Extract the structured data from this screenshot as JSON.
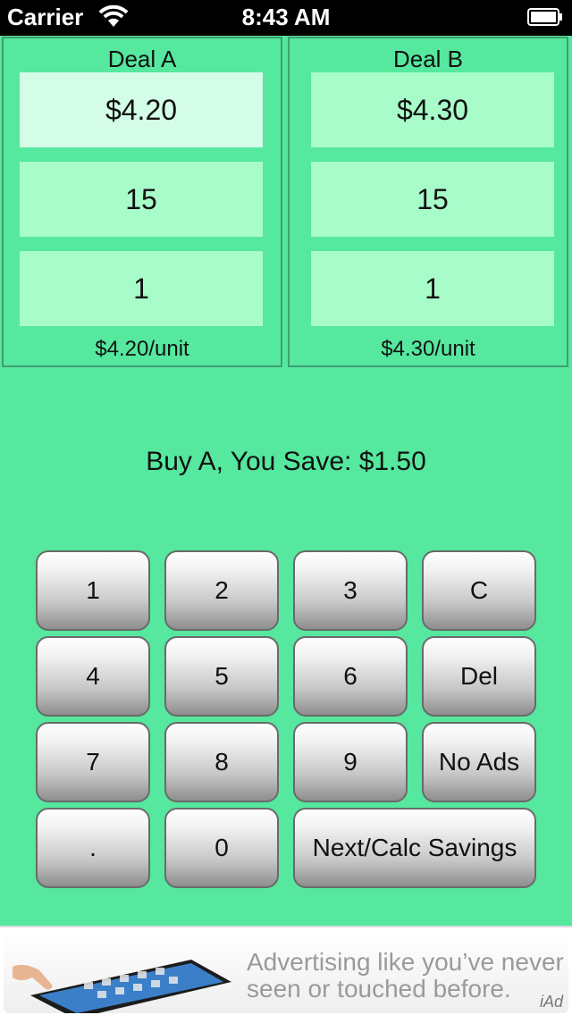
{
  "status_bar": {
    "carrier": "Carrier",
    "time": "8:43 AM"
  },
  "deal_a": {
    "title": "Deal A",
    "price": "$4.20",
    "quantity": "15",
    "units": "1",
    "unit_price": "$4.20/unit"
  },
  "deal_b": {
    "title": "Deal B",
    "price": "$4.30",
    "quantity": "15",
    "units": "1",
    "unit_price": "$4.30/unit"
  },
  "result": "Buy A, You Save: $1.50",
  "keypad": {
    "k1": "1",
    "k2": "2",
    "k3": "3",
    "kc": "C",
    "k4": "4",
    "k5": "5",
    "k6": "6",
    "kdel": "Del",
    "k7": "7",
    "k8": "8",
    "k9": "9",
    "knoads": "No Ads",
    "kdot": ".",
    "k0": "0",
    "knext": "Next/Calc Savings"
  },
  "ad": {
    "text": "Advertising like you’ve never seen or touched before.",
    "brand": "iAd"
  },
  "colors": {
    "background": "#55e89e",
    "field": "#a8fcc9",
    "active_field": "#d4fde8"
  }
}
